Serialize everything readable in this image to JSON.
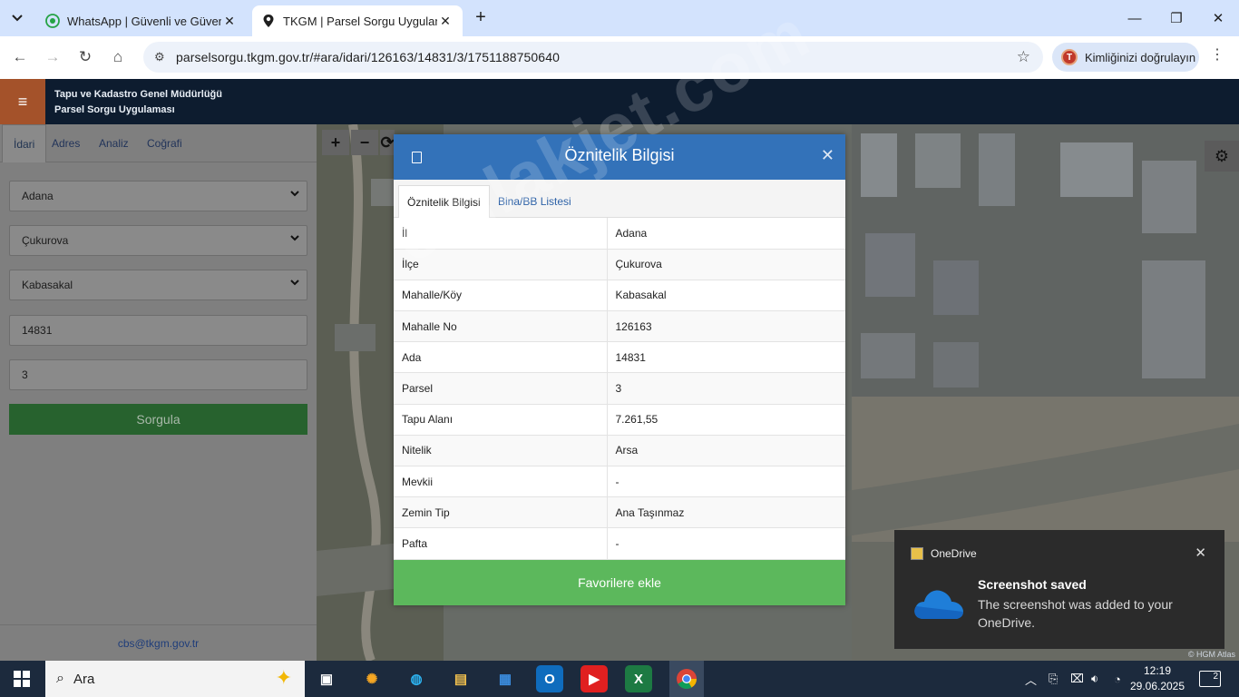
{
  "browser": {
    "tabs": [
      {
        "title": "WhatsApp | Güvenli ve Güvenilir",
        "active": false
      },
      {
        "title": "TKGM | Parsel Sorgu Uygulaması",
        "active": true
      }
    ],
    "url": "parselsorgu.tkgm.gov.tr/#ara/idari/126163/14831/3/1751188750640",
    "profile_label": "Kimliğinizi doğrulayın",
    "profile_initial": "T"
  },
  "app": {
    "org_name": "Tapu ve Kadastro Genel Müdürlüğü",
    "app_name": "Parsel Sorgu Uygulaması"
  },
  "sidebar": {
    "tabs": [
      "İdari",
      "Adres",
      "Analiz",
      "Coğrafi"
    ],
    "province": "Adana",
    "district": "Çukurova",
    "neighborhood": "Kabasakal",
    "block": "14831",
    "parcel": "3",
    "query_button": "Sorgula",
    "footer_email": "cbs@tkgm.gov.tr"
  },
  "map": {
    "zoom_in": "+",
    "zoom_out": "−",
    "attribution": "© HGM Atlas",
    "watermark": "emlakjet.com"
  },
  "modal": {
    "title": "Öznitelik Bilgisi",
    "tabs": [
      "Öznitelik Bilgisi",
      "Bina/BB Listesi"
    ],
    "rows": [
      {
        "label": "İl",
        "value": "Adana"
      },
      {
        "label": "İlçe",
        "value": "Çukurova"
      },
      {
        "label": "Mahalle/Köy",
        "value": "Kabasakal"
      },
      {
        "label": "Mahalle No",
        "value": "126163"
      },
      {
        "label": "Ada",
        "value": "14831"
      },
      {
        "label": "Parsel",
        "value": "3"
      },
      {
        "label": "Tapu Alanı",
        "value": "7.261,55"
      },
      {
        "label": "Nitelik",
        "value": "Arsa"
      },
      {
        "label": "Mevkii",
        "value": "-"
      },
      {
        "label": "Zemin Tip",
        "value": "Ana Taşınmaz"
      },
      {
        "label": "Pafta",
        "value": "-"
      }
    ],
    "favorite_button": "Favorilere ekle"
  },
  "toast": {
    "app": "OneDrive",
    "title": "Screenshot saved",
    "message": "The screenshot was added to your OneDrive."
  },
  "taskbar": {
    "search_placeholder": "Ara",
    "time": "12:19",
    "date": "29.06.2025",
    "notification_count": "2"
  }
}
